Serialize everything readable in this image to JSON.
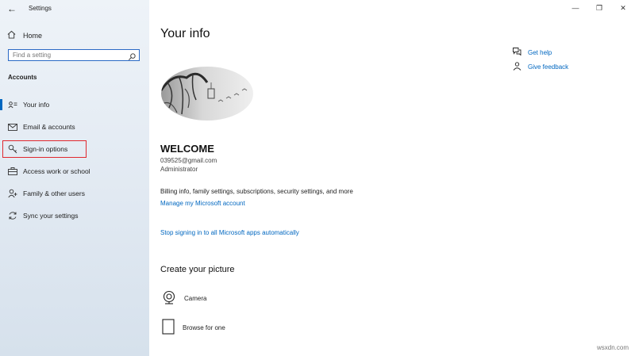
{
  "window": {
    "title": "Settings"
  },
  "sidebar": {
    "home": "Home",
    "search_placeholder": "Find a setting",
    "section_title": "Accounts",
    "items": [
      {
        "label": "Your info",
        "icon": "contact-card-icon",
        "selected": true
      },
      {
        "label": "Email & accounts",
        "icon": "mail-icon"
      },
      {
        "label": "Sign-in options",
        "icon": "key-icon",
        "highlighted": true
      },
      {
        "label": "Access work or school",
        "icon": "briefcase-icon"
      },
      {
        "label": "Family & other users",
        "icon": "person-add-icon"
      },
      {
        "label": "Sync your settings",
        "icon": "sync-icon"
      }
    ]
  },
  "main": {
    "heading": "Your info",
    "name": "WELCOME",
    "email": "039525@gmail.com",
    "role": "Administrator",
    "billing_text": "Billing info, family settings, subscriptions, security settings, and more",
    "manage_link": "Manage my Microsoft account",
    "stop_link": "Stop signing in to all Microsoft apps automatically",
    "picture_heading": "Create your picture",
    "picture_options": [
      {
        "label": "Camera",
        "icon": "camera-icon"
      },
      {
        "label": "Browse for one",
        "icon": "browse-file-icon"
      }
    ]
  },
  "help": {
    "get_help": "Get help",
    "give_feedback": "Give feedback"
  },
  "watermark": "wsxdn.com",
  "colors": {
    "accent": "#0067c0",
    "highlight_border": "#e0282e",
    "sidebar_bg": "#e6edf5"
  }
}
